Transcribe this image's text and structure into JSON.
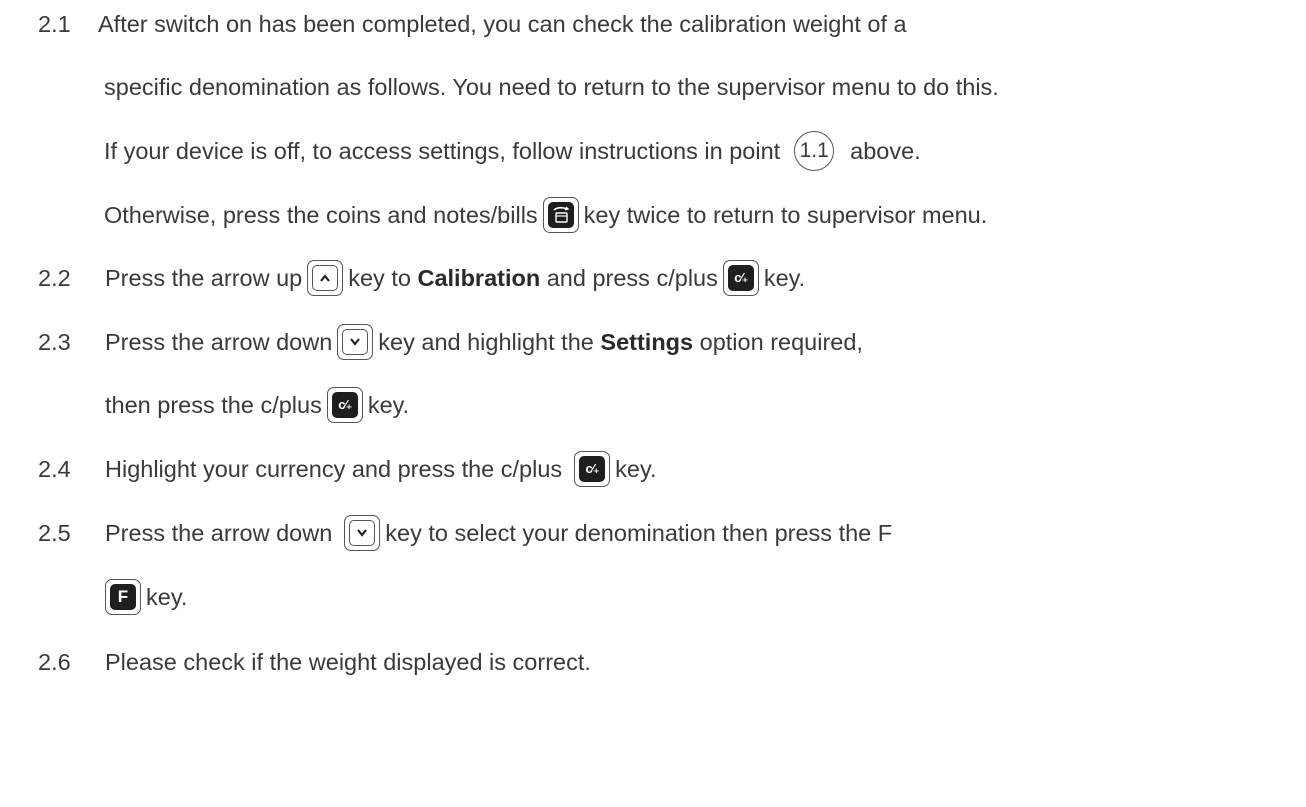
{
  "steps": [
    {
      "num": "2.1",
      "lines": [
        "After switch on has been completed, you can check the calibration weight of a",
        "specific denomination as follows. You need to return to the supervisor menu to do this."
      ]
    },
    {
      "l3a": "If your device is off, to access settings, follow instructions in point",
      "ref": "1.1",
      "l3b": "above."
    },
    {
      "l4a": "Otherwise, press the coins and notes/bills",
      "l4b": "key twice to return to supervisor menu."
    },
    {
      "num": "2.2",
      "a": "Press the arrow up",
      "b": "key to ",
      "bold": "Calibration",
      "c": " and press c/plus",
      "d": "key."
    },
    {
      "num": "2.3",
      "a": "Press the arrow down",
      "b": "key and highlight the ",
      "bold": "Settings",
      "c": " option required,",
      "line2a": "then press the c/plus",
      "line2b": "key."
    },
    {
      "num": "2.4",
      "a": "Highlight your currency and press the c/plus",
      "b": "key."
    },
    {
      "num": "2.5",
      "a": "Press the arrow down",
      "b": "key to select your denomination then press the F",
      "line2": "key."
    },
    {
      "num": "2.6",
      "a": "Please check if the weight displayed is correct."
    }
  ],
  "keys": {
    "arrow_up": "^",
    "arrow_down": "v",
    "c_plus": "c/+",
    "f": "F",
    "coins_notes": "coins-notes-icon"
  }
}
